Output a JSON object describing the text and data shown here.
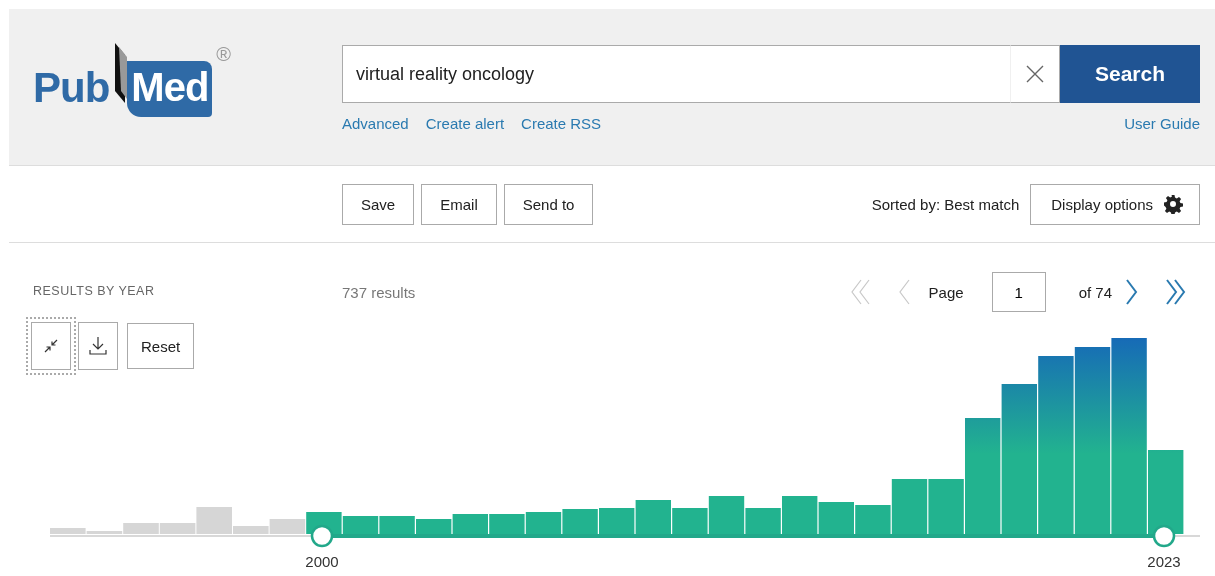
{
  "logo": {
    "text_1": "Pub",
    "text_2": "Med",
    "mark": "®"
  },
  "search": {
    "value": "virtual reality oncology",
    "button": "Search"
  },
  "links": [
    "Advanced",
    "Create alert",
    "Create RSS"
  ],
  "help_link": "User Guide",
  "actions": [
    "Save",
    "Email",
    "Send to"
  ],
  "sort": "Sorted by: Best match",
  "display_button": "Display options",
  "timeline": {
    "title": "RESULTS BY YEAR",
    "reset": "Reset",
    "start_year": "2000",
    "end_year": "2023",
    "tools": [
      {
        "kind": "collapse",
        "focused": true
      },
      {
        "kind": "download",
        "focused": false
      }
    ]
  },
  "results_count": "737 results",
  "pager": {
    "label": "Page",
    "value": "1",
    "total": "of 74",
    "controls": [
      {
        "kind": "first",
        "disabled": true
      },
      {
        "kind": "previous",
        "disabled": true
      },
      {
        "kind": "next",
        "disabled": false
      },
      {
        "kind": "last",
        "disabled": false
      }
    ]
  }
}
